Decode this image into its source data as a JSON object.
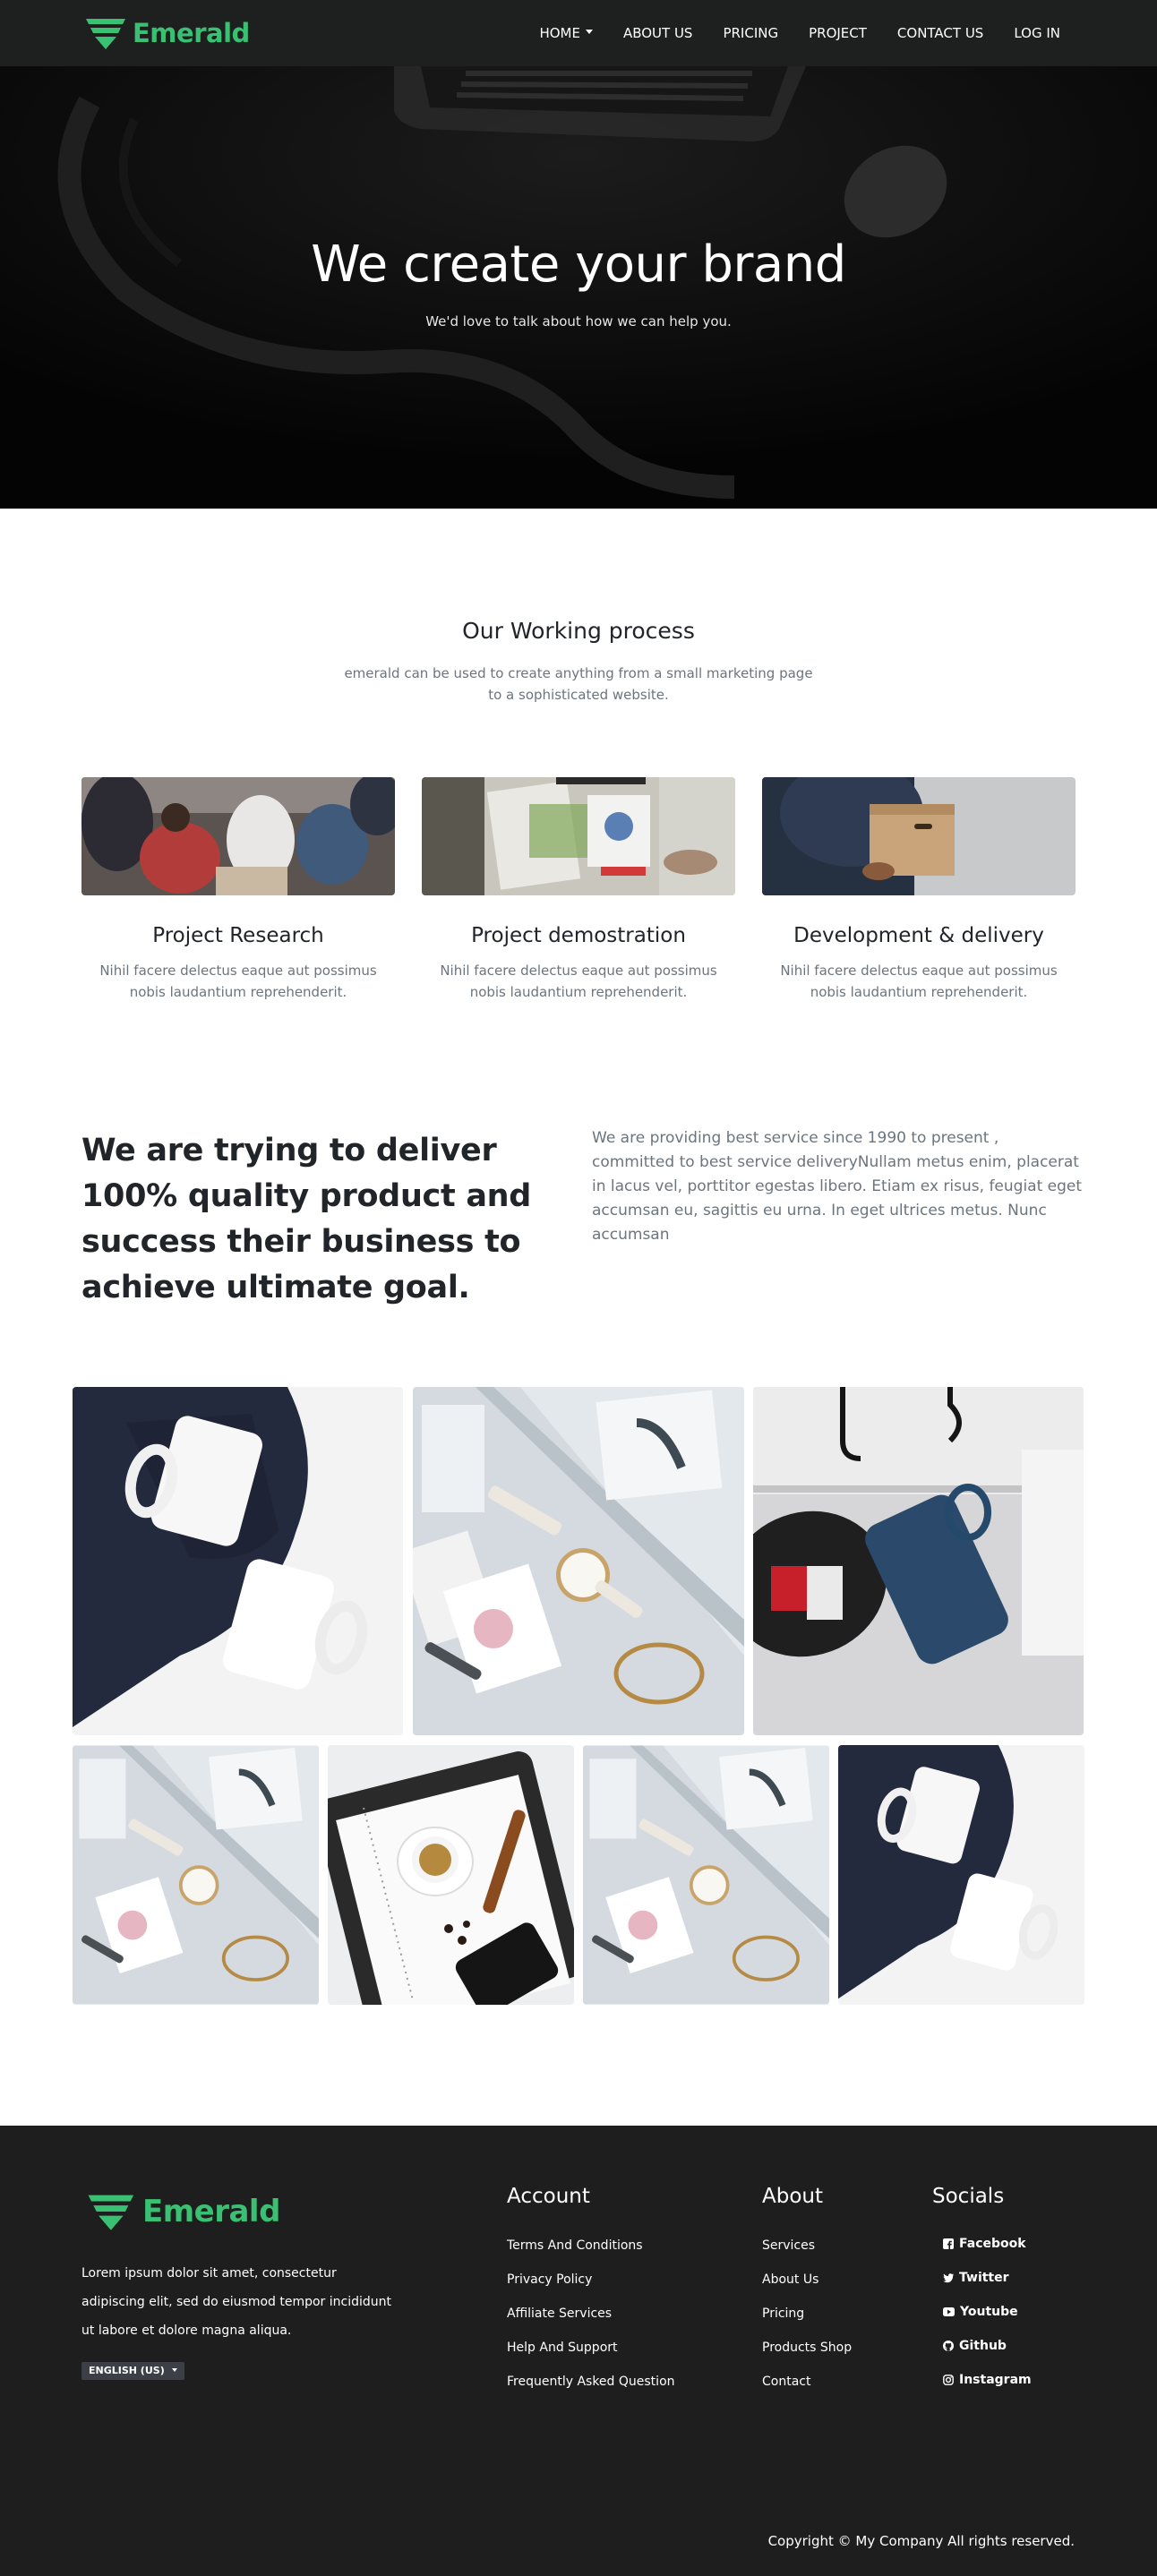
{
  "brand": {
    "name": "Emerald",
    "color": "#39c072"
  },
  "nav": {
    "items": [
      {
        "label": "HOME",
        "dropdown": true
      },
      {
        "label": "ABOUT US"
      },
      {
        "label": "PRICING"
      },
      {
        "label": "PROJECT"
      },
      {
        "label": "CONTACT US"
      },
      {
        "label": "LOG IN"
      }
    ]
  },
  "hero": {
    "title": "We create your brand",
    "subtitle": "We'd love to talk about how we can help you."
  },
  "process": {
    "title": "Our Working process",
    "subtitle": "emerald can be used to create anything from a small marketing page to a sophisticated website.",
    "cards": [
      {
        "title": "Project Research",
        "text": "Nihil facere delectus eaque aut possimus nobis laudantium reprehenderit.",
        "image": "team-meeting-photo"
      },
      {
        "title": "Project demostration",
        "text": "Nihil facere delectus eaque aut possimus nobis laudantium reprehenderit.",
        "image": "desk-charts-photo"
      },
      {
        "title": "Development & delivery",
        "text": "Nihil facere delectus eaque aut possimus nobis laudantium reprehenderit.",
        "image": "box-delivery-photo"
      }
    ]
  },
  "mission": {
    "heading": "We are trying to deliver 100% quality product and success their business to achieve ultimate goal.",
    "text": "We are providing best service since 1990 to present , committed to best service deliveryNullam metus enim, placerat in lacus vel, porttitor egestas libero. Etiam ex risus, feugiat eget accumsan eu, sagittis eu urna. In eget ultrices metus. Nunc accumsan"
  },
  "gallery": {
    "images": [
      "mugs-photo",
      "watch-desk-photo",
      "hanging-mugs-photo",
      "watch-desk-photo",
      "coffee-notebook-photo",
      "watch-desk-photo",
      "mugs-photo"
    ]
  },
  "footer": {
    "description": "Lorem ipsum dolor sit amet, consectetur adipiscing elit, sed do eiusmod tempor incididunt ut labore et dolore magna aliqua.",
    "language": "ENGLISH (US)",
    "account": {
      "title": "Account",
      "links": [
        "Terms And Conditions",
        "Privacy Policy",
        "Affiliate Services",
        "Help And Support",
        "Frequently Asked Question"
      ]
    },
    "about": {
      "title": "About",
      "links": [
        "Services",
        "About Us",
        "Pricing",
        "Products Shop",
        "Contact"
      ]
    },
    "socials": {
      "title": "Socials",
      "links": [
        {
          "label": "Facebook",
          "icon": "facebook-icon"
        },
        {
          "label": "Twitter",
          "icon": "twitter-icon"
        },
        {
          "label": "Youtube",
          "icon": "youtube-icon"
        },
        {
          "label": "Github",
          "icon": "github-icon"
        },
        {
          "label": "Instagram",
          "icon": "instagram-icon"
        }
      ]
    },
    "copyright": "Copyright © My Company All rights reserved."
  }
}
